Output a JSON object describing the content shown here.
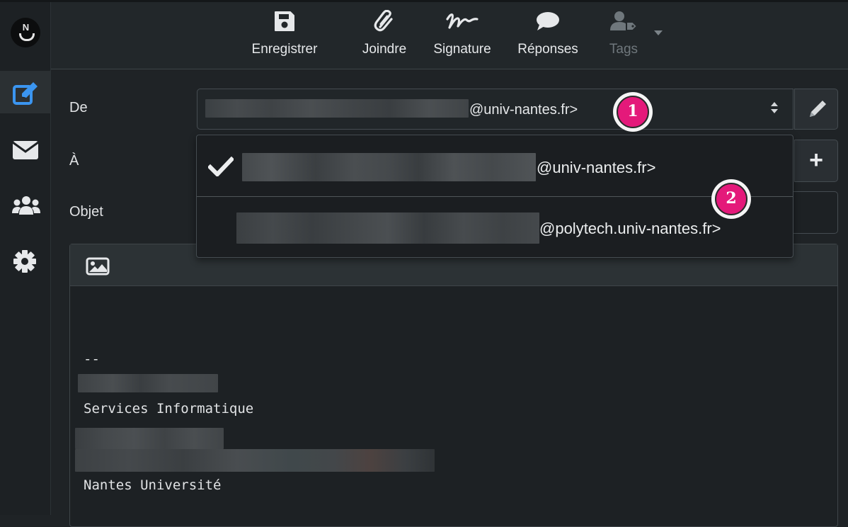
{
  "rail": {
    "logo_text": "N",
    "items": [
      {
        "name": "compose",
        "active": true
      },
      {
        "name": "mail",
        "active": false
      },
      {
        "name": "contacts",
        "active": false
      },
      {
        "name": "settings",
        "active": false
      }
    ]
  },
  "toolbar": {
    "save_label": "Enregistrer",
    "attach_label": "Joindre",
    "signature_label": "Signature",
    "responses_label": "Réponses",
    "tags_label": "Tags"
  },
  "form": {
    "from_label": "De",
    "to_label": "À",
    "subject_label": "Objet",
    "from_value_suffix": "@univ-nantes.fr>"
  },
  "dropdown": {
    "options": [
      {
        "suffix": "@univ-nantes.fr>",
        "selected": true
      },
      {
        "suffix": "@polytech.univ-nantes.fr>",
        "selected": false
      }
    ]
  },
  "signature": {
    "separator": "--",
    "line_services": "Services Informatique",
    "line_university": "Nantes Université"
  },
  "callouts": [
    "1",
    "2"
  ],
  "colors": {
    "accent_blue": "#3b95f0",
    "callout_pink": "#e4197a",
    "background": "#1f2326"
  }
}
